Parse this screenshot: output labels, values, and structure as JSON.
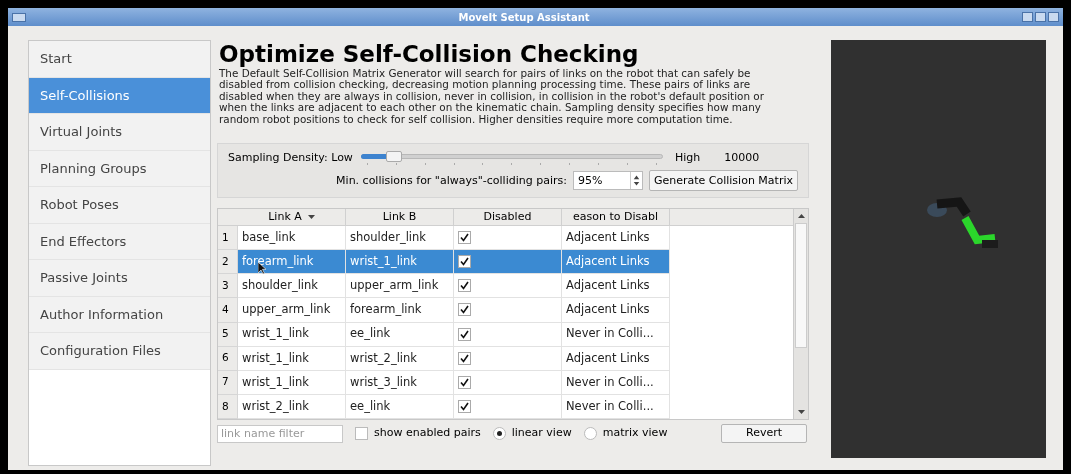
{
  "window": {
    "title": "MoveIt Setup Assistant"
  },
  "sidebar": {
    "items": [
      {
        "label": "Start",
        "selected": false
      },
      {
        "label": "Self-Collisions",
        "selected": true
      },
      {
        "label": "Virtual Joints",
        "selected": false
      },
      {
        "label": "Planning Groups",
        "selected": false
      },
      {
        "label": "Robot Poses",
        "selected": false
      },
      {
        "label": "End Effectors",
        "selected": false
      },
      {
        "label": "Passive Joints",
        "selected": false
      },
      {
        "label": "Author Information",
        "selected": false
      },
      {
        "label": "Configuration Files",
        "selected": false
      }
    ]
  },
  "heading": "Optimize Self-Collision Checking",
  "description": "The Default Self-Collision Matrix Generator will search for pairs of links on the robot that can safely be disabled from collision checking, decreasing motion planning processing time. These pairs of links are disabled when they are always in collision, never in collision, in collision in the robot's default position or when the links are adjacent to each other on the kinematic chain. Sampling density specifies how many random robot positions to check for self collision. Higher densities require more computation time.",
  "sampling": {
    "label": "Sampling Density: Low",
    "high_label": "High",
    "level": 0.09,
    "value": "10000"
  },
  "min_collisions": {
    "label": "Min. collisions for \"always\"-colliding pairs:",
    "value": "95%"
  },
  "generate_button": "Generate Collision Matrix",
  "table": {
    "columns": [
      "Link A",
      "Link B",
      "Disabled",
      "eason to Disabl"
    ],
    "rows": [
      {
        "number": "1",
        "link_a": "base_link",
        "link_b": "shoulder_link",
        "disabled": true,
        "reason": "Adjacent Links",
        "selected": false
      },
      {
        "number": "2",
        "link_a": "forearm_link",
        "link_b": "wrist_1_link",
        "disabled": true,
        "reason": "Adjacent Links",
        "selected": true
      },
      {
        "number": "3",
        "link_a": "shoulder_link",
        "link_b": "upper_arm_link",
        "disabled": true,
        "reason": "Adjacent Links",
        "selected": false
      },
      {
        "number": "4",
        "link_a": "upper_arm_link",
        "link_b": "forearm_link",
        "disabled": true,
        "reason": "Adjacent Links",
        "selected": false
      },
      {
        "number": "5",
        "link_a": "wrist_1_link",
        "link_b": "ee_link",
        "disabled": true,
        "reason": "Never in Colli...",
        "selected": false
      },
      {
        "number": "6",
        "link_a": "wrist_1_link",
        "link_b": "wrist_2_link",
        "disabled": true,
        "reason": "Adjacent Links",
        "selected": false
      },
      {
        "number": "7",
        "link_a": "wrist_1_link",
        "link_b": "wrist_3_link",
        "disabled": true,
        "reason": "Never in Colli...",
        "selected": false
      },
      {
        "number": "8",
        "link_a": "wrist_2_link",
        "link_b": "ee_link",
        "disabled": true,
        "reason": "Never in Colli...",
        "selected": false
      }
    ]
  },
  "filter": {
    "placeholder": "link name filter"
  },
  "show_enabled": {
    "label": "show enabled pairs",
    "checked": false
  },
  "views": [
    {
      "label": "linear view",
      "selected": true
    },
    {
      "label": "matrix view",
      "selected": false
    }
  ],
  "revert_button": "Revert"
}
